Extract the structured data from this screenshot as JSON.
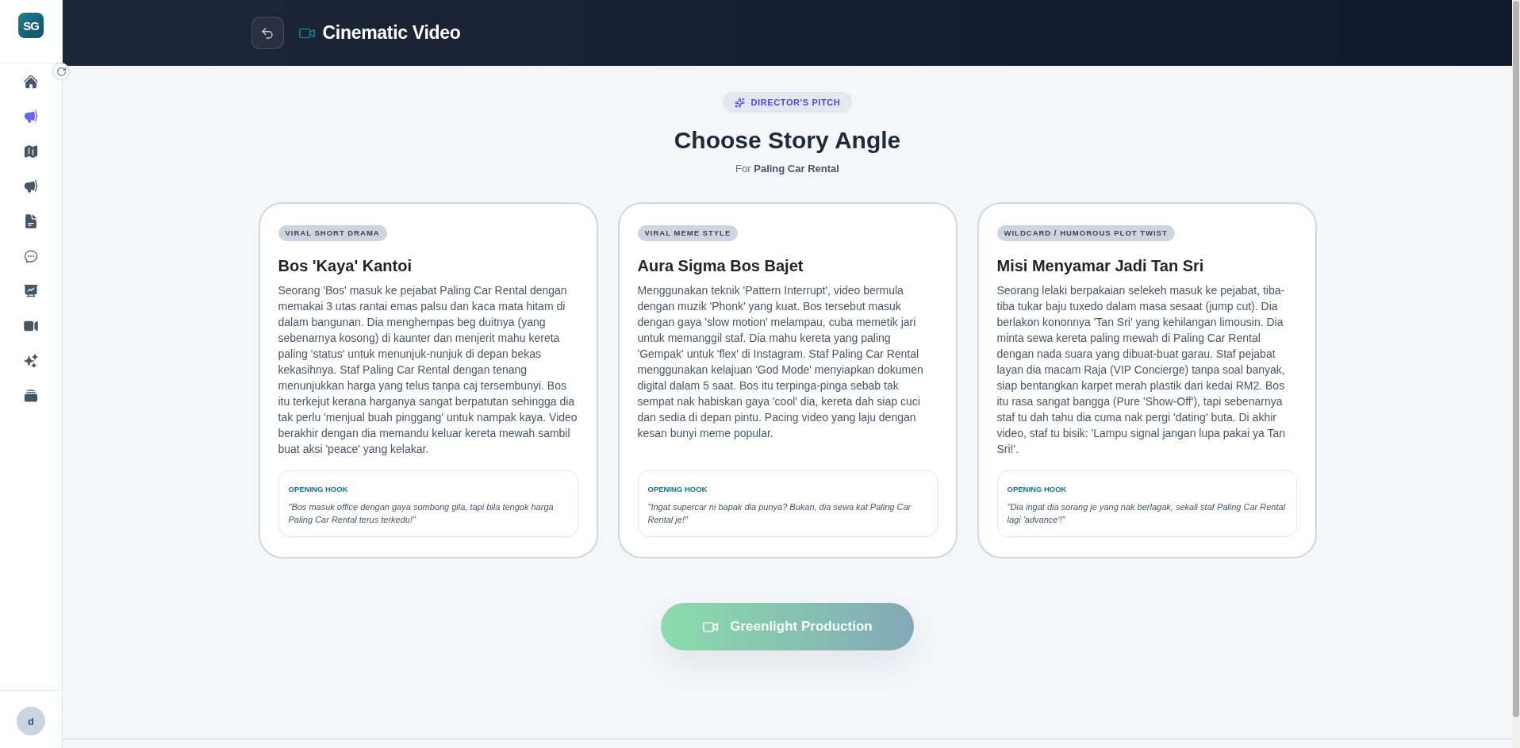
{
  "sidebar": {
    "logo": "SG",
    "items": [
      {
        "kind": "home",
        "selected": false
      },
      {
        "kind": "megaphone",
        "selected": true
      },
      {
        "kind": "map",
        "selected": false
      },
      {
        "kind": "megaphone",
        "selected": false
      },
      {
        "kind": "document",
        "selected": false
      },
      {
        "kind": "chat",
        "selected": false
      },
      {
        "kind": "presentation",
        "selected": false
      },
      {
        "kind": "video",
        "selected": false
      },
      {
        "kind": "sparkles",
        "selected": false
      },
      {
        "kind": "stack",
        "selected": false
      }
    ],
    "avatar": "d"
  },
  "header": {
    "title": "Cinematic Video"
  },
  "pitch": {
    "badge": "DIRECTOR'S PITCH",
    "title": "Choose Story Angle",
    "subtitle": "For **Paling Car Rental**"
  },
  "angles": [
    {
      "tag": "VIRAL SHORT DRAMA",
      "title": "Bos 'Kaya' Kantoi",
      "body": "Seorang 'Bos' masuk ke pejabat Paling Car Rental dengan memakai 3 utas rantai emas palsu dan kaca mata hitam di dalam bangunan. Dia menghempas beg duitnya (yang sebenarnya kosong) di kaunter dan menjerit mahu kereta paling 'status' untuk menunjuk-nunjuk di depan bekas kekasihnya. Staf Paling Car Rental dengan tenang menunjukkan harga yang telus tanpa caj tersembunyi. Bos itu terkejut kerana harganya sangat berpatutan sehingga dia tak perlu 'menjual buah pinggang' untuk nampak kaya. Video berakhir dengan dia memandu keluar kereta mewah sambil buat aksi 'peace' yang kelakar.",
      "hook_label": "OPENING HOOK",
      "hook": "\"Bos masuk office dengan gaya sombong gila, tapi bila tengok harga Paling Car Rental terus terkedu!\"",
      "selected": false
    },
    {
      "tag": "VIRAL MEME STYLE",
      "title": "Aura Sigma Bos Bajet",
      "body": "Menggunakan teknik 'Pattern Interrupt', video bermula dengan muzik 'Phonk' yang kuat. Bos tersebut masuk dengan gaya 'slow motion' melampau, cuba memetik jari untuk memanggil staf. Dia mahu kereta yang paling 'Gempak' untuk 'flex' di Instagram. Staf Paling Car Rental menggunakan kelajuan 'God Mode' menyiapkan dokumen digital dalam 5 saat. Bos itu terpinga-pinga sebab tak sempat nak habiskan gaya 'cool' dia, kereta dah siap cuci dan sedia di depan pintu. Pacing video yang laju dengan kesan bunyi meme popular.",
      "hook_label": "OPENING HOOK",
      "hook": "\"Ingat supercar ni bapak dia punya? Bukan, dia sewa kat Paling Car Rental je!\"",
      "selected": false
    },
    {
      "tag": "WILDCARD / HUMOROUS PLOT TWIST",
      "title": "Misi Menyamar Jadi Tan Sri",
      "body": "Seorang lelaki berpakaian selekeh masuk ke pejabat, tiba-tiba tukar baju tuxedo dalam masa sesaat (jump cut). Dia berlakon kononnya 'Tan Sri' yang kehilangan limousin. Dia minta sewa kereta paling mewah di Paling Car Rental dengan nada suara yang dibuat-buat garau. Staf pejabat layan dia macam Raja (VIP Concierge) tanpa soal banyak, siap bentangkan karpet merah plastik dari kedai RM2. Bos itu rasa sangat bangga (Pure 'Show-Off'), tapi sebenarnya staf tu dah tahu dia cuma nak pergi 'dating' buta. Di akhir video, staf tu bisik: 'Lampu signal jangan lupa pakai ya Tan Sri!'.",
      "hook_label": "OPENING HOOK",
      "hook": "\"Dia ingat dia sorang je yang nak berlagak, sekali staf Paling Car Rental lagi 'advance'!\"",
      "selected": false
    }
  ],
  "action": {
    "label": "Greenlight Production",
    "disabled": true
  }
}
